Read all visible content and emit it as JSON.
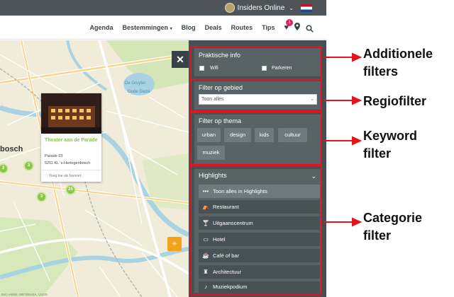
{
  "topbar": {
    "insiders_label": "Insiders Online",
    "chevron": "⌄"
  },
  "nav": {
    "items": [
      "Agenda",
      "Bestemmingen",
      "Blog",
      "Deals",
      "Routes",
      "Tips"
    ],
    "bestemmingen_caret": "▾",
    "favorites_count": "1"
  },
  "map": {
    "city_label": "bosch",
    "water_label_1": "De Gruyter",
    "water_label_2": "Oude Dieze",
    "credit": "Esri, HERE, METI/NASA, USGS",
    "clusters": [
      "3",
      "3",
      "3",
      "25"
    ],
    "popup": {
      "title": "Theater aan de Parade",
      "address_line1": "Parade 23",
      "address_line2": "5211 KL 's-Hertogenbosch",
      "favorite_text": "Voeg toe als favoriet"
    },
    "close_symbol": "✕"
  },
  "sidebar": {
    "practical": {
      "title": "Praktische info",
      "options": [
        "Wifi",
        "Parkeren"
      ]
    },
    "region": {
      "title": "Filter op gebied",
      "selected": "Toon alles"
    },
    "theme": {
      "title": "Filter op thema",
      "tags": [
        "urban",
        "design",
        "kids",
        "cultuur",
        "muziek"
      ]
    },
    "highlights": {
      "title": "Highlights",
      "categories": [
        {
          "label": "Toon alles in Highlights",
          "icon": "dots-icon",
          "active": true
        },
        {
          "label": "Restaurant",
          "icon": "restaurant-icon",
          "active": false
        },
        {
          "label": "Uitgaanscentrum",
          "icon": "cocktail-icon",
          "active": false
        },
        {
          "label": "Hotel",
          "icon": "bed-icon",
          "active": false
        },
        {
          "label": "Café of bar",
          "icon": "cup-icon",
          "active": false
        },
        {
          "label": "Architectuur",
          "icon": "tower-icon",
          "active": false
        },
        {
          "label": "Muziekpodium",
          "icon": "music-icon",
          "active": false
        }
      ]
    }
  },
  "annotations": {
    "additional_line1": "Additionele",
    "additional_line2": "filters",
    "region": "Regiofilter",
    "keyword_line1": "Keyword",
    "keyword_line2": "filter",
    "category_line1": "Categorie",
    "category_line2": "filter"
  },
  "colors": {
    "highlight_red": "#e3141b",
    "sidebar_bg": "#455055",
    "section_bg": "#586367",
    "accent_green": "#8ec641",
    "locate_orange": "#f1a31c"
  }
}
